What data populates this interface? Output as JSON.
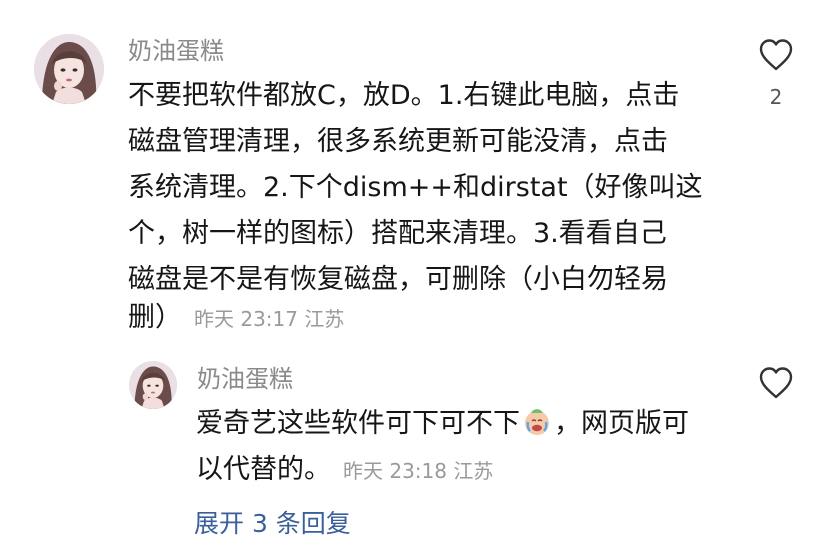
{
  "colors": {
    "username": "#8a8a8a",
    "text": "#161616",
    "meta": "#9a9a9a",
    "link": "#3a5f9a",
    "icon_stroke": "#333333"
  },
  "comment": {
    "username": "奶油蛋糕",
    "lines": [
      "不要把软件都放C，放D。1.右键此电脑，点击",
      "磁盘管理清理，很多系统更新可能没清，点击",
      "系统清理。2.下个dism++和dirstat（好像叫这",
      "个，树一样的图标）搭配来清理。3.看看自己",
      "磁盘是不是有恢复磁盘，可删除（小白勿轻易",
      "删）"
    ],
    "timestamp": "昨天 23:17",
    "location": "江苏",
    "like_icon": "heart-outline-icon",
    "like_count": "2"
  },
  "reply": {
    "username": "奶油蛋糕",
    "line1_before_emoji": "爱奇艺这些软件可下可不下",
    "emoji": "crying-face-emoji",
    "line1_after_emoji": "，网页版可",
    "line2": "以代替的。",
    "timestamp": "昨天 23:18",
    "location": "江苏",
    "like_icon": "heart-outline-icon"
  },
  "expand_replies": {
    "label": "展开 3 条回复"
  }
}
